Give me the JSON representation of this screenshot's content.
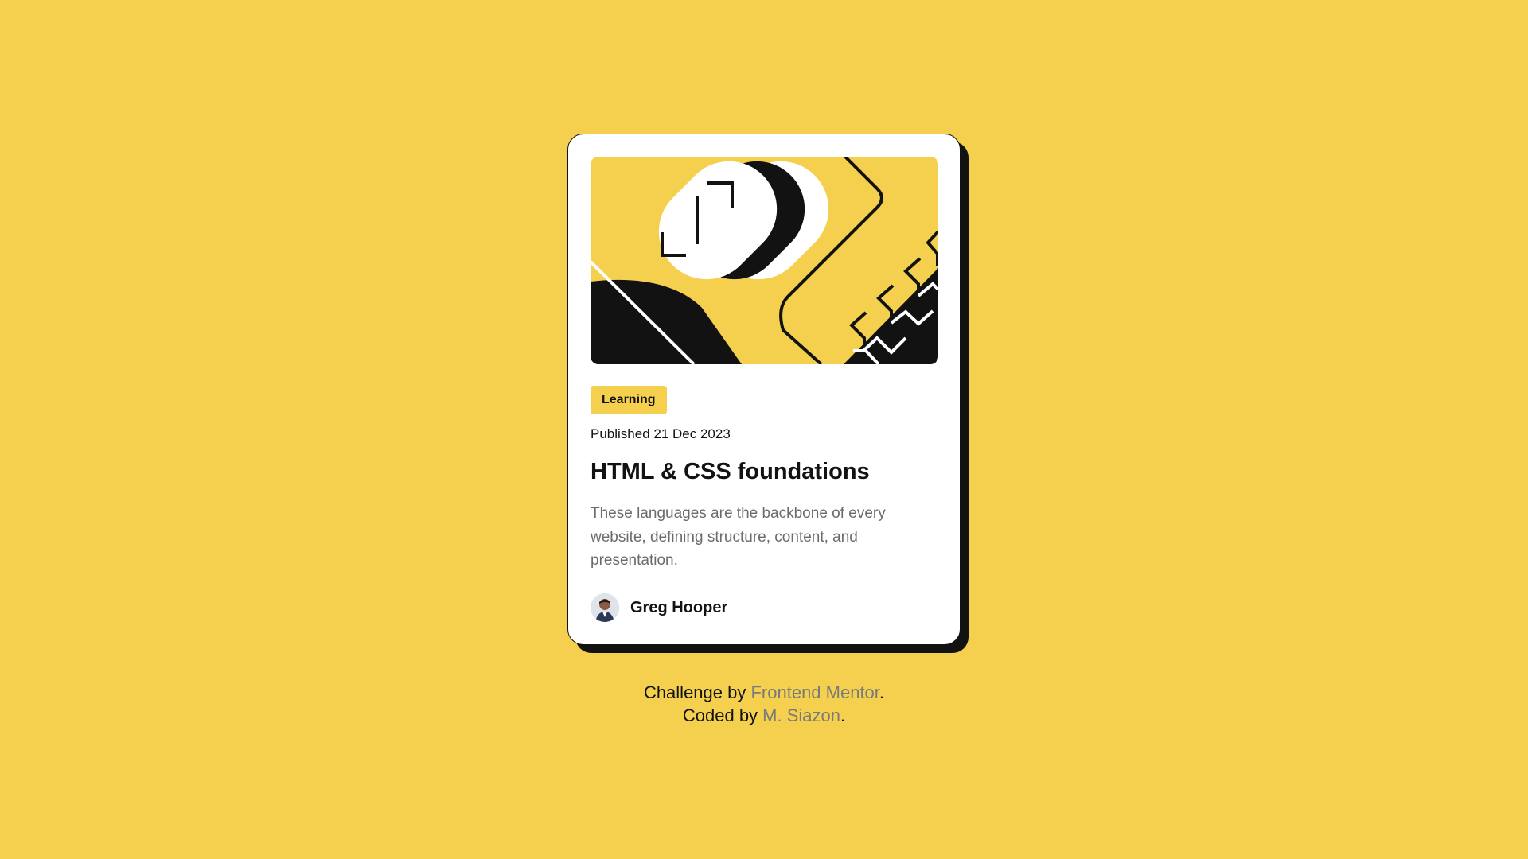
{
  "colors": {
    "background": "#F4D04E",
    "card": "#FFFFFF",
    "ink": "#121212",
    "muted_text": "#6B6B6B",
    "link": "#7A7A7A"
  },
  "card": {
    "hero_image": "abstract-illustration",
    "tag": "Learning",
    "published": "Published 21 Dec 2023",
    "title": "HTML & CSS foundations",
    "description": "These languages are the backbone of every website, defining structure, content, and presentation.",
    "author": {
      "avatar": "avatar-photo",
      "name": "Greg Hooper"
    }
  },
  "attribution": {
    "line1_prefix": "Challenge by ",
    "line1_link": "Frontend Mentor",
    "line1_suffix": ".",
    "line2_prefix": "Coded by ",
    "line2_link": "M. Siazon",
    "line2_suffix": "."
  }
}
